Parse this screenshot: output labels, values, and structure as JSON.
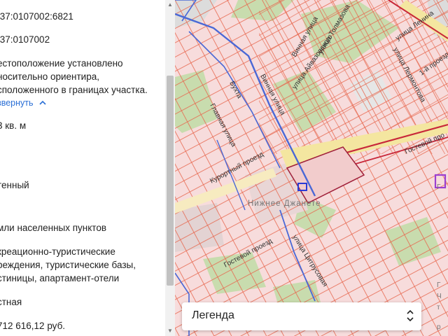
{
  "panel": {
    "cadastral_number": ":37:0107002:6821",
    "quarter_number": ":37:0107002",
    "location": [
      "естоположение установлено",
      "носительно ориентира,",
      "сположенного в границах участка."
    ],
    "expand_link": "звернуть",
    "area": "3 кв. м",
    "status": "тенный",
    "category": "мли населенных пунктов",
    "permitted_use": [
      "креационно-туристические",
      "реждения, туристические базы,",
      "стиницы, апартамент-отели"
    ],
    "ownership": "стная",
    "cadastral_value": "712 616,12 руб."
  },
  "map": {
    "streets": {
      "lenin": "улица Ленина",
      "pervaya_pr": "1-й проезд",
      "lermontov": "улица Лермонтова",
      "tolmazova": "улица Толмазова",
      "vinnaya_upper": "Винная улица",
      "aivazovsky": "улица Айвазовского",
      "bukhta": "Бухта",
      "vinnaya": "Винная улица",
      "glavnaya": "Главная улица",
      "gostevoy_upper": "Гостевой про",
      "kurortny": "Курортный проезд",
      "gostevoy": "Гостевой проезд",
      "tsitrusovaya": "улица Цитрусовая"
    },
    "place_label": "Нижнее Джанете",
    "edge_letters": [
      "Г",
      "Г",
      "Ч",
      "т",
      "р"
    ]
  },
  "legend": {
    "label": "Легенда"
  },
  "colors": {
    "parcel_fill": "#f7dcdc",
    "parcel_line": "#e8684f",
    "boundary_blue": "#4a68d6",
    "zone_green": "#c8dcae",
    "zone_gray": "#dcdcdc",
    "road_yellow": "#f4e6a0",
    "selected_purple": "#9b3fd1",
    "link_blue": "#2a6fd6"
  }
}
